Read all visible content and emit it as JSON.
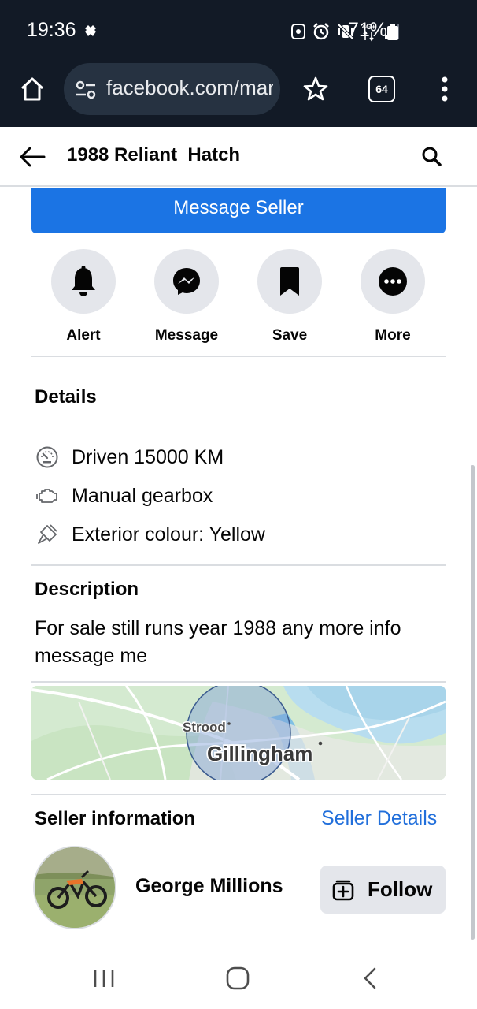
{
  "status_bar": {
    "time": "19:36",
    "battery": "71%",
    "network": "4G+"
  },
  "browser": {
    "url": "facebook.com/marketplace",
    "tab_count": "64"
  },
  "header": {
    "title": "1988 Reliant  Hatch"
  },
  "actions": {
    "message_seller": "Message Seller",
    "items": [
      {
        "label": "Alert",
        "icon": "bell-icon"
      },
      {
        "label": "Message",
        "icon": "messenger-icon"
      },
      {
        "label": "Save",
        "icon": "bookmark-icon"
      },
      {
        "label": "More",
        "icon": "more-icon"
      }
    ]
  },
  "details": {
    "title": "Details",
    "items": [
      {
        "text": "Driven 15000 KM",
        "icon": "speedometer-icon"
      },
      {
        "text": "Manual gearbox",
        "icon": "engine-icon"
      },
      {
        "text": "Exterior colour: Yellow",
        "icon": "paintbrush-icon"
      }
    ]
  },
  "description": {
    "title": "Description",
    "text": "For sale still runs year 1988 any more info message me"
  },
  "map": {
    "label_small": "Strood",
    "label_large": "Gillingham"
  },
  "seller": {
    "title": "Seller information",
    "details_link": "Seller Details",
    "name": "George Millions",
    "follow_label": "Follow"
  },
  "colors": {
    "primary": "#1b74e4",
    "link": "#216fdb",
    "chrome": "#121a26",
    "button_grey": "#e4e6eb"
  }
}
